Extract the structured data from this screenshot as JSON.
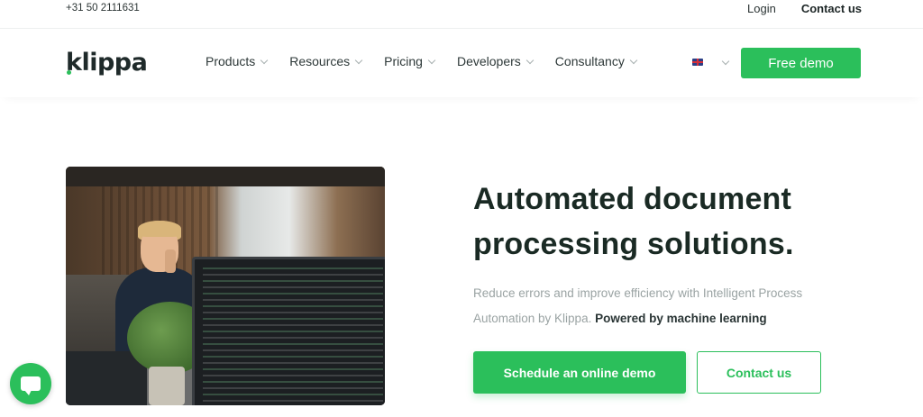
{
  "topbar": {
    "phone": "+31 50 2111631",
    "login": "Login",
    "contact": "Contact us"
  },
  "nav": {
    "logo": "klippa",
    "items": [
      {
        "label": "Products"
      },
      {
        "label": "Resources"
      },
      {
        "label": "Pricing"
      },
      {
        "label": "Developers"
      },
      {
        "label": "Consultancy"
      }
    ],
    "language_icon": "uk-flag-icon",
    "demo_button": "Free demo"
  },
  "hero": {
    "title": "Automated document processing solutions.",
    "description": "Reduce errors and improve efficiency with Intelligent Process Automation by Klippa.",
    "description_bold": "Powered by machine learning",
    "primary_button": "Schedule an online demo",
    "secondary_button": "Contact us"
  },
  "chat": {
    "icon": "chat-icon"
  },
  "colors": {
    "accent": "#2bbf5b",
    "heading": "#1a2a24",
    "muted": "#9aa3a3"
  }
}
